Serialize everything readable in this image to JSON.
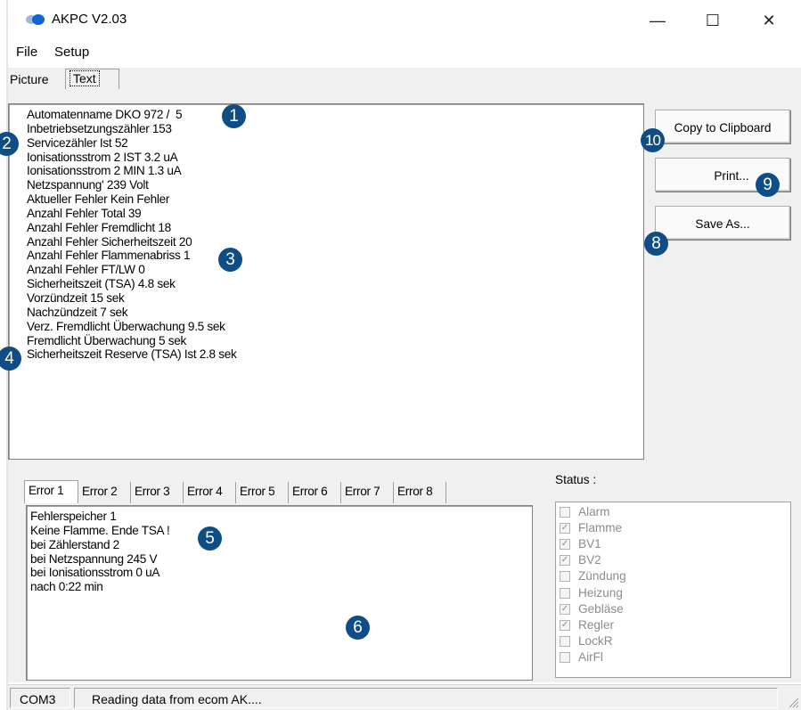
{
  "window": {
    "title": "AKPC V2.03",
    "controls": {
      "minimize": "—",
      "maximize": "☐",
      "close": "✕"
    }
  },
  "menu": {
    "items": [
      "File",
      "Setup"
    ]
  },
  "top_tabs": [
    {
      "label": "Picture",
      "active": false
    },
    {
      "label": "Text",
      "active": true
    }
  ],
  "main_text": {
    "lines": [
      "Automatenname DKO 972 /  5",
      "Inbetriebsetzungszähler 153",
      "Servicezähler Ist 52",
      "Ionisationsstrom 2 IST 3.2 uA",
      "Ionisationsstrom 2 MIN 1.3 uA",
      "Netzspannung' 239 Volt",
      "Aktueller Fehler Kein Fehler",
      "Anzahl Fehler Total 39",
      "Anzahl Fehler Fremdlicht 18",
      "Anzahl Fehler Sicherheitszeit 20",
      "Anzahl Fehler Flammenabriss 1",
      "Anzahl Fehler FT/LW 0",
      "Sicherheitszeit (TSA) 4.8 sek",
      "Vorzündzeit 15 sek",
      "Nachzündzeit 7 sek",
      "Verz. Fremdlicht Überwachung 9.5 sek",
      "Fremdlicht Überwachung 5 sek",
      "Sicherheitszeit Reserve (TSA) Ist 2.8 sek"
    ]
  },
  "buttons": {
    "copy": "Copy to Clipboard",
    "print": "Print...",
    "save_as": "Save As..."
  },
  "error_tabs": [
    {
      "label": "Error 1",
      "active": true
    },
    {
      "label": "Error 2",
      "active": false
    },
    {
      "label": "Error 3",
      "active": false
    },
    {
      "label": "Error 4",
      "active": false
    },
    {
      "label": "Error 5",
      "active": false
    },
    {
      "label": "Error 6",
      "active": false
    },
    {
      "label": "Error 7",
      "active": false
    },
    {
      "label": "Error 8",
      "active": false
    }
  ],
  "error_text": {
    "lines": [
      "Fehlerspeicher 1",
      "Keine Flamme. Ende TSA !",
      "bei Zählerstand 2",
      "bei Netzspannung 245 V",
      "bei Ionisationsstrom 0 uA",
      "nach 0:22 min"
    ]
  },
  "status": {
    "label": "Status :",
    "items": [
      {
        "label": "Alarm",
        "checked": false
      },
      {
        "label": "Flamme",
        "checked": true
      },
      {
        "label": "BV1",
        "checked": true
      },
      {
        "label": "BV2",
        "checked": true
      },
      {
        "label": "Zündung",
        "checked": false
      },
      {
        "label": "Heizung",
        "checked": false
      },
      {
        "label": "Gebläse",
        "checked": true
      },
      {
        "label": "Regler",
        "checked": true
      },
      {
        "label": "LockR",
        "checked": false
      },
      {
        "label": "AirFl",
        "checked": false
      }
    ]
  },
  "statusbar": {
    "port": "COM3",
    "message": "Reading data from ecom AK...."
  },
  "callouts": [
    "1",
    "2",
    "3",
    "4",
    "5",
    "6",
    "8",
    "9",
    "10"
  ],
  "colors": {
    "callout": "#0f4d86",
    "app_icon": "#1463d6",
    "disabled_text": "#8c8c8c",
    "client_bg": "#f0f0f0"
  }
}
